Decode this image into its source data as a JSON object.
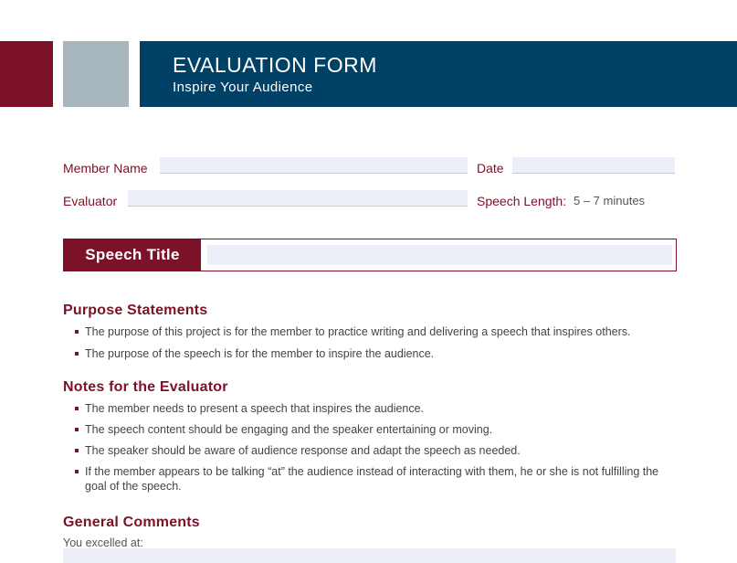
{
  "header": {
    "title": "EVALUATION FORM",
    "subtitle": "Inspire Your Audience"
  },
  "fields": {
    "member_name_label": "Member Name",
    "date_label": "Date",
    "evaluator_label": "Evaluator",
    "speech_length_label": "Speech Length:",
    "speech_length_value": "5 – 7 minutes",
    "speech_title_label": "Speech Title"
  },
  "purpose": {
    "heading": "Purpose Statements",
    "items": [
      "The purpose of this project is for the member to practice writing and delivering a speech that inspires others.",
      "The purpose of the speech is for the member to inspire the audience."
    ]
  },
  "notes": {
    "heading": "Notes for the Evaluator",
    "items": [
      "The member needs to present a speech that inspires the audience.",
      "The speech content should be engaging and the speaker entertaining or moving.",
      "The speaker should be aware of audience response and adapt the speech as needed.",
      "If the member appears to be talking “at” the audience instead of interacting with them, he or she is not fulfilling the goal of the speech."
    ]
  },
  "comments": {
    "heading": "General Comments",
    "excelled_label": "You excelled at:"
  },
  "colors": {
    "maroon": "#7b1228",
    "navy": "#004165",
    "gray": "#a8b7bd",
    "field_fill": "#eceef8"
  }
}
